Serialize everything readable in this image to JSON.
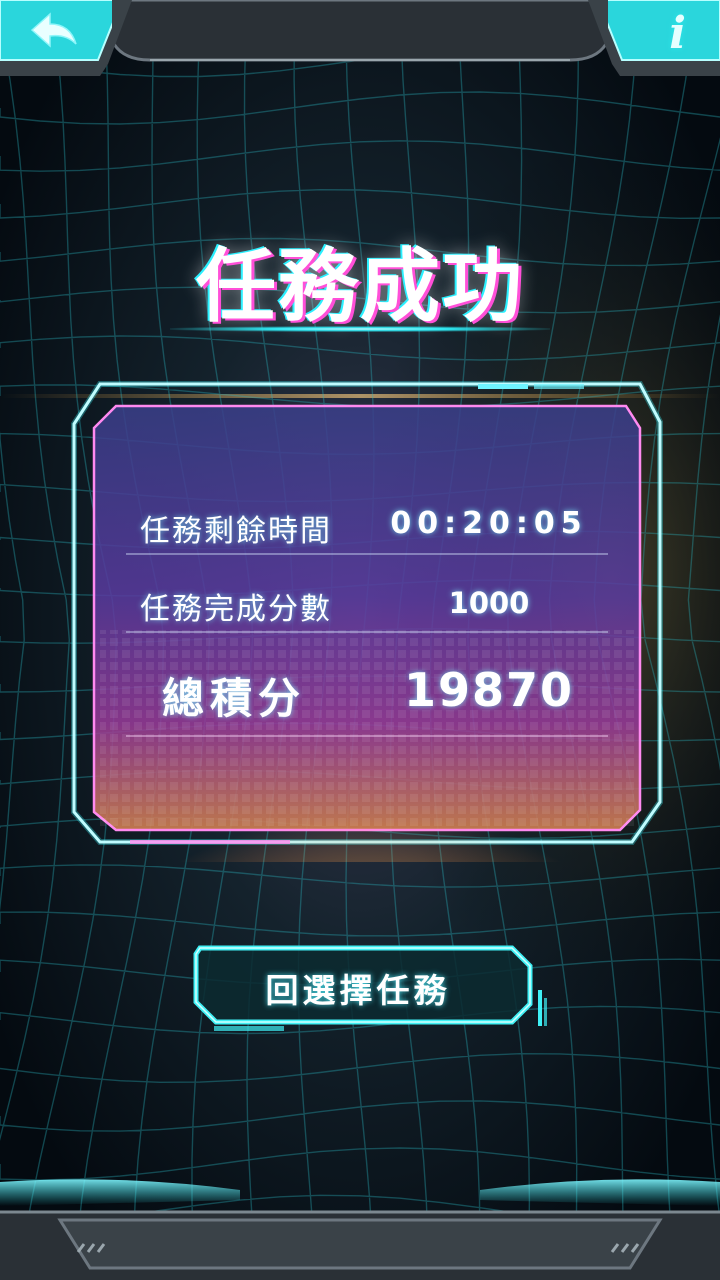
{
  "top_bar": {
    "back_icon": "back-arrow-icon",
    "info_icon": "info-icon",
    "info_glyph": "i"
  },
  "title": "任務成功",
  "result": {
    "rows": [
      {
        "label": "任務剩餘時間",
        "value": "00:20:05"
      },
      {
        "label": "任務完成分數",
        "value": "1000"
      }
    ],
    "total": {
      "label": "總積分",
      "value": "19870"
    }
  },
  "button": {
    "label": "回選擇任務"
  },
  "colors": {
    "accent_cyan": "#2ee6ea",
    "accent_magenta": "#ff4fd8",
    "panel_purple": "#6a3fb0",
    "background": "#061018"
  }
}
